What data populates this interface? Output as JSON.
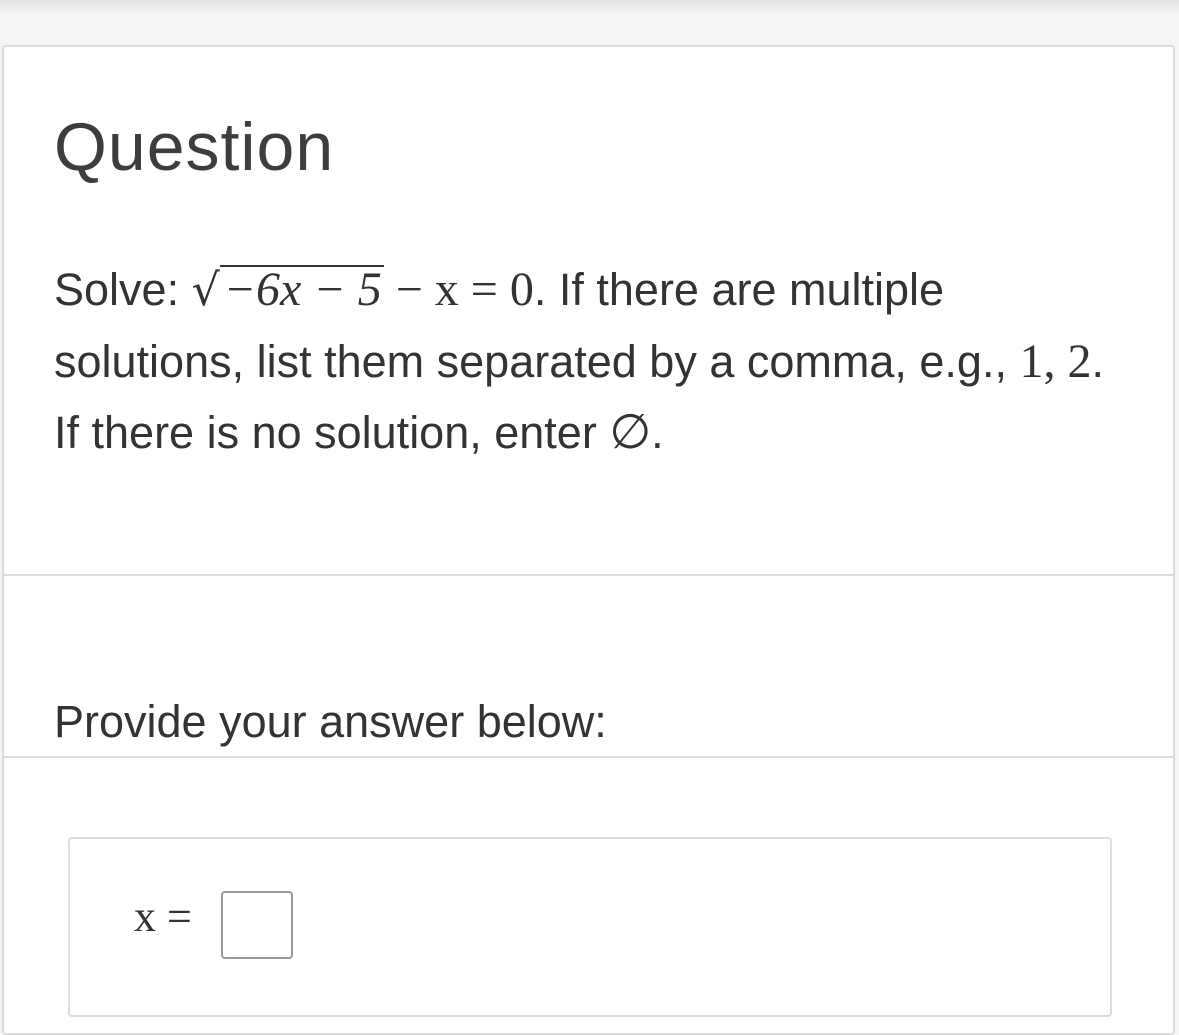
{
  "question": {
    "title": "Question",
    "solve_label": "Solve:",
    "equation": {
      "radicand": "−6x − 5",
      "after": "− x = 0"
    },
    "text_1": ". If there are multiple solutions, list them separated by a comma, e.g., ",
    "example": "1, 2",
    "text_2": ". If there is no solution, enter ",
    "empty_set_symbol": "∅",
    "text_3": "."
  },
  "answer_section": {
    "prompt": "Provide your answer below:",
    "variable_label": "x =",
    "input_value": ""
  }
}
